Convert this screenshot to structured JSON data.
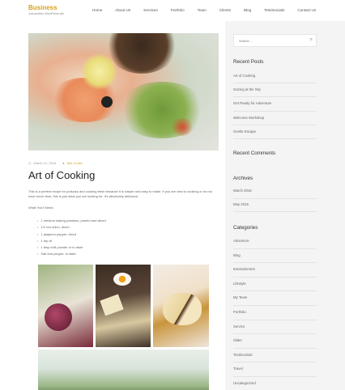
{
  "brand": {
    "name": "Business",
    "tagline": "Just another WordPress site"
  },
  "nav": [
    "Home",
    "About Us",
    "Services",
    "Portfolio",
    "Team",
    "Clients",
    "Blog",
    "Testimonials",
    "Contact Us"
  ],
  "post": {
    "date": "March 12, 2016",
    "author": "Mia Cruise",
    "title": "Art of Cooking",
    "excerpt": "This is a perfect recipe for potlucks and cooking fresh because it is simple and easy to make. If you are new to cooking or do not have much time, this is just what you are looking for. It's absolutely delicious!",
    "need_label": "What You'll Need:",
    "ingredients": [
      "1 medium baking potatoes, peeled and sliced",
      "1/2 red onion, diced",
      "1 jalapeno pepper, diced",
      "1 tsp oil",
      "1 tbsp chili powder or to taste",
      "Salt and pepper, to taste"
    ]
  },
  "sidebar": {
    "search_placeholder": "Search ...",
    "recent_posts_title": "Recent Posts",
    "recent_posts": [
      "Art of Cooking",
      "Gazing at the Sky",
      "Get Ready for Adventure",
      "Welcome Workshop",
      "Gentle Escape"
    ],
    "recent_comments_title": "Recent Comments",
    "archives_title": "Archives",
    "archives": [
      "March 2016",
      "May 2015"
    ],
    "categories_title": "Categories",
    "categories": [
      "Adventure",
      "Blog",
      "Entertainment",
      "Lifestyle",
      "My Team",
      "Portfolio",
      "Service",
      "Slider",
      "Testimonials",
      "Travel",
      "Uncategorized"
    ]
  }
}
